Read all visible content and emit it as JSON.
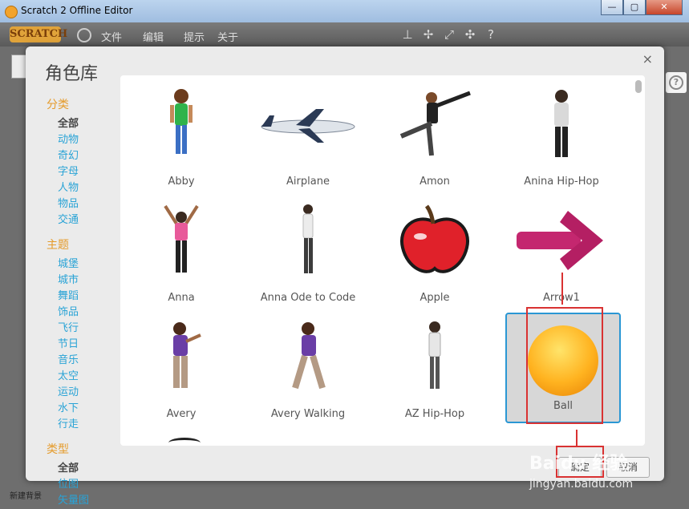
{
  "window": {
    "title": "Scratch 2 Offline Editor",
    "buttons": [
      "—",
      "▢",
      "✕"
    ]
  },
  "menubar": {
    "logo": "SCRATCH",
    "items": [
      "文件",
      "编辑",
      "提示",
      "关于"
    ]
  },
  "editor": {
    "new_backdrop_label": "新建背景",
    "help_icon": "?"
  },
  "modal": {
    "title": "角色库",
    "close": "×",
    "sidebar": {
      "category_head": "分类",
      "categories": [
        "全部",
        "动物",
        "奇幻",
        "字母",
        "人物",
        "物品",
        "交通"
      ],
      "theme_head": "主题",
      "themes": [
        "城堡",
        "城市",
        "舞蹈",
        "饰品",
        "飞行",
        "节日",
        "音乐",
        "太空",
        "运动",
        "水下",
        "行走"
      ],
      "type_head": "类型",
      "types": [
        "全部",
        "位图",
        "矢量图"
      ]
    },
    "sprites": [
      {
        "name": "Abby",
        "icon": "girl-figure"
      },
      {
        "name": "Airplane",
        "icon": "airplane"
      },
      {
        "name": "Amon",
        "icon": "dancer-figure"
      },
      {
        "name": "Anina Hip-Hop",
        "icon": "dancer-figure"
      },
      {
        "name": "Anna",
        "icon": "dancer-figure"
      },
      {
        "name": "Anna Ode to Code",
        "icon": "dancer-figure"
      },
      {
        "name": "Apple",
        "icon": "apple"
      },
      {
        "name": "Arrow1",
        "icon": "arrow"
      },
      {
        "name": "Avery",
        "icon": "girl-figure"
      },
      {
        "name": "Avery Walking",
        "icon": "girl-figure"
      },
      {
        "name": "AZ Hip-Hop",
        "icon": "dancer-figure"
      },
      {
        "name": "Ball",
        "icon": "ball",
        "selected": true
      }
    ],
    "ok_label": "确定",
    "cancel_label": "取消"
  },
  "watermark": {
    "brand": "Baidu 经验",
    "url": "jingyan.baidu.com"
  },
  "colors": {
    "accent": "#29a3d6",
    "section_head": "#e59b2b",
    "annotation": "#d93232",
    "selected_border": "#2a97d4"
  }
}
